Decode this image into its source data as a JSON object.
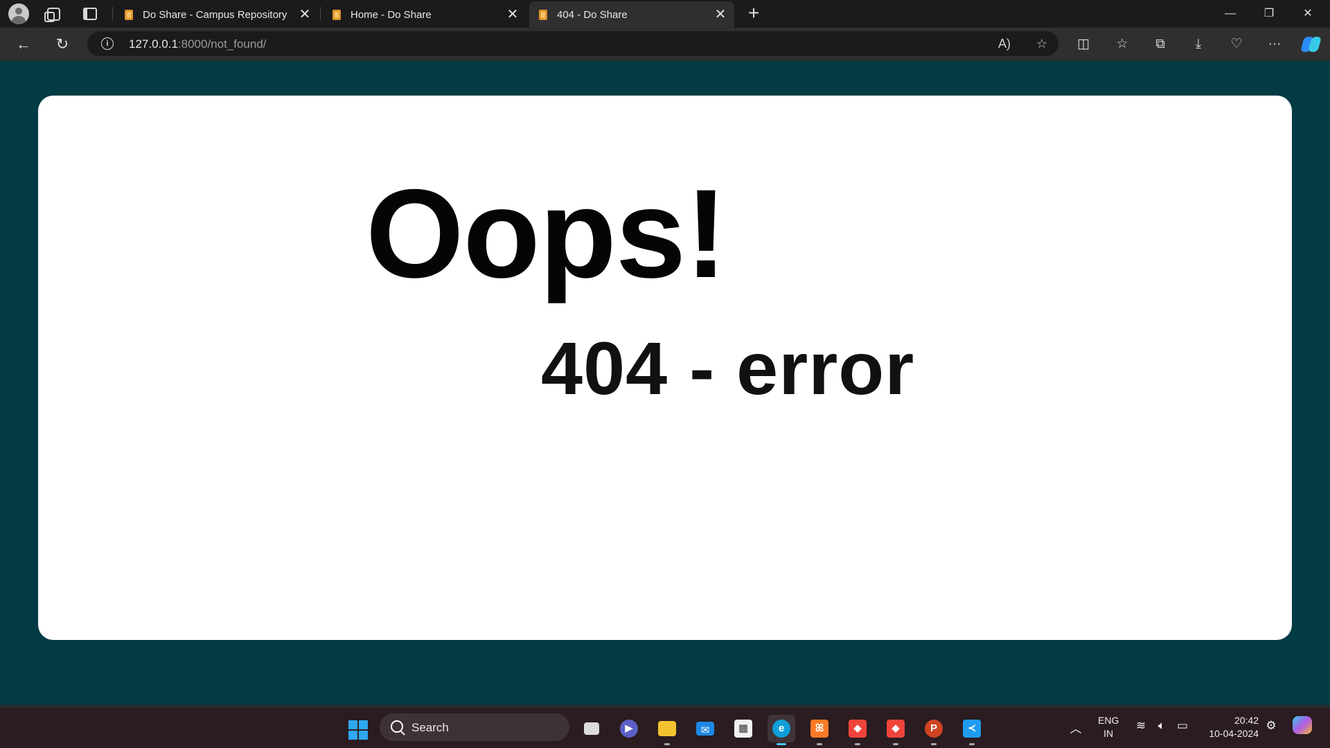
{
  "tabs": [
    {
      "title": "Do Share - Campus Repository",
      "active": false
    },
    {
      "title": "Home - Do Share",
      "active": false
    },
    {
      "title": "404 - Do Share",
      "active": true
    }
  ],
  "address": {
    "host": "127.0.0.1",
    "path": ":8000/not_found/"
  },
  "page": {
    "heading": "Oops!",
    "subheading": "404 - error"
  },
  "taskbar": {
    "search_label": "Search",
    "lang_line1": "ENG",
    "lang_line2": "IN",
    "time": "20:42",
    "date": "10-04-2024"
  },
  "colors": {
    "page_bg": "#023b44",
    "card_bg": "#ffffff",
    "text": "#050505"
  }
}
